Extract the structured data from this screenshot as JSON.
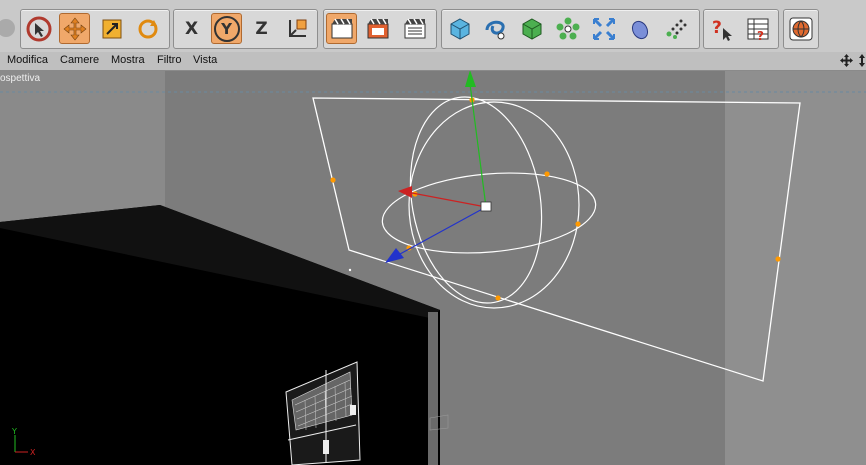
{
  "menu": {
    "items": [
      "Modifica",
      "Camere",
      "Mostra",
      "Filtro",
      "Vista"
    ]
  },
  "viewport": {
    "label": "ospettiva"
  },
  "toolbar": {
    "axis_x": "X",
    "axis_y": "Y",
    "axis_z": "Z"
  },
  "colors": {
    "toolbar_bg": "#c9c9c9",
    "active_tool": "#f0a86a",
    "axis_y": "#22aa22",
    "axis_x": "#cc2222",
    "axis_z": "#2222cc",
    "handle": "#ff9900"
  },
  "icons": {
    "left": [
      "select-arrow-icon",
      "move-icon",
      "scale-icon",
      "rotate-icon"
    ],
    "axes": [
      "x-axis-lock-icon",
      "y-axis-lock-icon",
      "z-axis-lock-icon",
      "coordinate-system-icon"
    ],
    "render": [
      "render-view-icon",
      "render-picture-viewer-icon",
      "render-settings-icon"
    ],
    "objects": [
      "cube-icon",
      "spline-icon",
      "nurbs-icon",
      "array-icon",
      "deformer-icon",
      "scene-icon",
      "mograph-icon"
    ],
    "help": [
      "context-help-icon",
      "schedule-help-icon"
    ],
    "globe": [
      "web-globe-icon"
    ]
  }
}
